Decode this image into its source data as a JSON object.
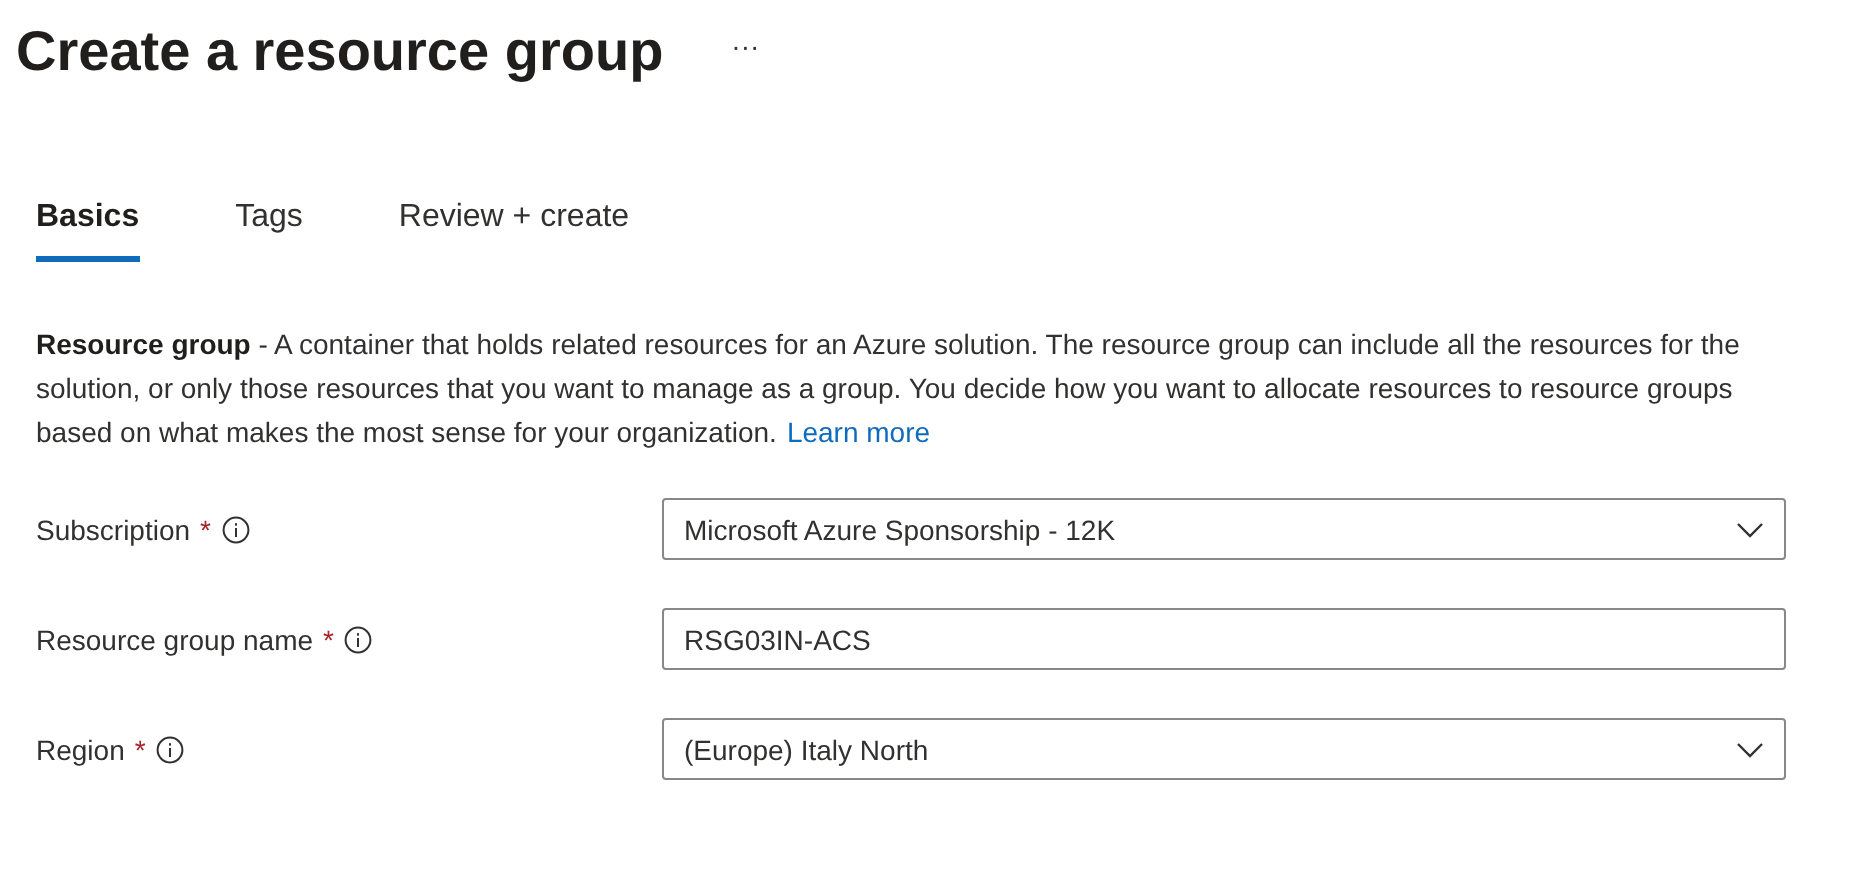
{
  "header": {
    "title": "Create a resource group",
    "more": "···"
  },
  "tabs": [
    {
      "label": "Basics",
      "selected": true
    },
    {
      "label": "Tags",
      "selected": false
    },
    {
      "label": "Review + create",
      "selected": false
    }
  ],
  "description": {
    "text": "**Resource group** - A container that holds related resources for an Azure solution. The resource group can include all the resources for the solution, or only those resources that you want to manage as a group. You decide how you want to allocate resources to resource groups based on what makes the most sense for your organization.",
    "link": "Learn more"
  },
  "fields": [
    {
      "kind": "dropdown",
      "label": "Subscription",
      "required_mark": "*",
      "value": "Microsoft Azure Sponsorship - 12K"
    },
    {
      "kind": "text",
      "label": "Resource group name",
      "required_mark": "*",
      "value": "RSG03IN-ACS"
    },
    {
      "kind": "dropdown",
      "label": "Region",
      "required_mark": "*",
      "value": "(Europe) Italy North"
    }
  ]
}
